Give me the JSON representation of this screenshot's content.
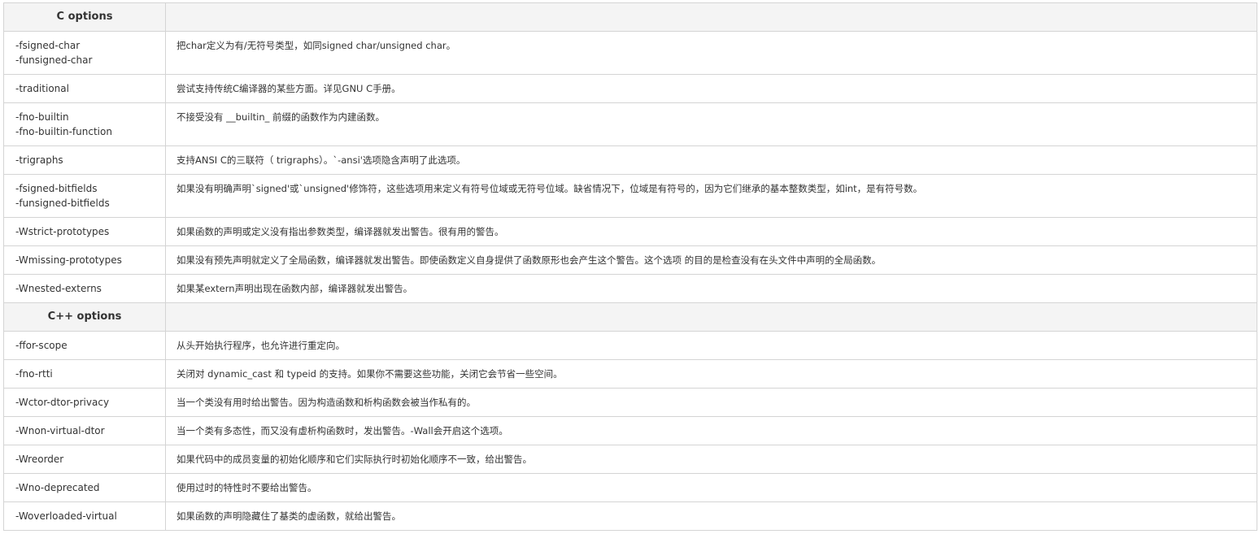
{
  "sections": [
    {
      "title": "C options",
      "rows": [
        {
          "options": [
            "-fsigned-char",
            "-funsigned-char"
          ],
          "desc": "把char定义为有/无符号类型，如同signed char/unsigned char。"
        },
        {
          "options": [
            "-traditional"
          ],
          "desc": "尝试支持传统C编译器的某些方面。详见GNU C手册。"
        },
        {
          "options": [
            "-fno-builtin",
            "-fno-builtin-function"
          ],
          "desc": "不接受没有 __builtin_ 前缀的函数作为内建函数。"
        },
        {
          "options": [
            "-trigraphs"
          ],
          "desc": "支持ANSI C的三联符（ trigraphs）。`-ansi'选项隐含声明了此选项。"
        },
        {
          "options": [
            "-fsigned-bitfields",
            "-funsigned-bitfields"
          ],
          "desc": "如果没有明确声明`signed'或`unsigned'修饰符，这些选项用来定义有符号位域或无符号位域。缺省情况下，位域是有符号的，因为它们继承的基本整数类型，如int，是有符号数。"
        },
        {
          "options": [
            "-Wstrict-prototypes"
          ],
          "desc": "如果函数的声明或定义没有指出参数类型，编译器就发出警告。很有用的警告。"
        },
        {
          "options": [
            "-Wmissing-prototypes"
          ],
          "desc": "如果没有预先声明就定义了全局函数，编译器就发出警告。即使函数定义自身提供了函数原形也会产生这个警告。这个选项 的目的是检查没有在头文件中声明的全局函数。"
        },
        {
          "options": [
            "-Wnested-externs"
          ],
          "desc": "如果某extern声明出现在函数内部，编译器就发出警告。"
        }
      ]
    },
    {
      "title": "C++ options",
      "rows": [
        {
          "options": [
            "-ffor-scope"
          ],
          "desc": "从头开始执行程序，也允许进行重定向。"
        },
        {
          "options": [
            "-fno-rtti"
          ],
          "desc": "关闭对 dynamic_cast 和 typeid 的支持。如果你不需要这些功能，关闭它会节省一些空间。"
        },
        {
          "options": [
            "-Wctor-dtor-privacy"
          ],
          "desc": "当一个类没有用时给出警告。因为构造函数和析构函数会被当作私有的。"
        },
        {
          "options": [
            "-Wnon-virtual-dtor"
          ],
          "desc": "当一个类有多态性，而又没有虚析构函数时，发出警告。-Wall会开启这个选项。"
        },
        {
          "options": [
            "-Wreorder"
          ],
          "desc": "如果代码中的成员变量的初始化顺序和它们实际执行时初始化顺序不一致，给出警告。"
        },
        {
          "options": [
            "-Wno-deprecated"
          ],
          "desc": "使用过时的特性时不要给出警告。"
        },
        {
          "options": [
            "-Woverloaded-virtual"
          ],
          "desc": "如果函数的声明隐藏住了基类的虚函数，就给出警告。"
        }
      ]
    }
  ]
}
